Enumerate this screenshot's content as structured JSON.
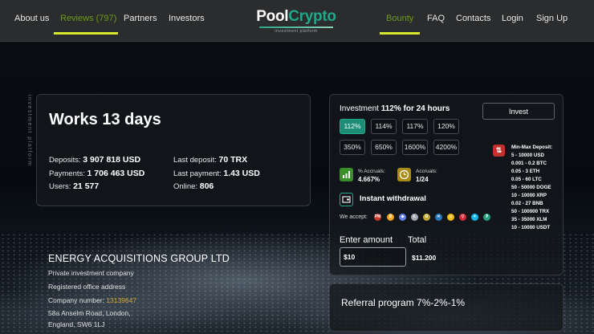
{
  "nav": {
    "left": [
      "About us",
      "Reviews (797)",
      "Partners",
      "Investors"
    ],
    "right": [
      "Bounty",
      "FAQ",
      "Contacts",
      "Login",
      "Sign Up"
    ]
  },
  "logo": {
    "pool": "Pool",
    "crypto": "Crypto",
    "tagline": "investment platform"
  },
  "vertical_text": "investment platform",
  "stats": {
    "title": "Works 13 days",
    "deposits_label": "Deposits:",
    "deposits": "3 907 818 USD",
    "payments_label": "Payments:",
    "payments": "1 706 463 USD",
    "users_label": "Users:",
    "users": "21 577",
    "last_deposit_label": "Last deposit:",
    "last_deposit": "70 TRX",
    "last_payment_label": "Last payment:",
    "last_payment": "1.43 USD",
    "online_label": "Online:",
    "online": "806"
  },
  "company": {
    "name": "ENERGY ACQUISITIONS GROUP LTD",
    "type": "Private investment company",
    "registered": "Registered office address",
    "number_label": "Company number:",
    "number": "13139647",
    "address1": "58a Anselm Road, London,",
    "address2": "England, SW6 1LJ"
  },
  "invest": {
    "head_prefix": "Investment",
    "head_bold": "112% for 24 hours",
    "button": "Invest",
    "rates": [
      "112%",
      "114%",
      "117%",
      "120%",
      "350%",
      "650%",
      "1600%",
      "4200%"
    ],
    "selected_rate": "112%",
    "accruals_pct_label": "% Accruals:",
    "accruals_pct": "4.667%",
    "accruals_label": "Accruals:",
    "accruals": "1/24",
    "instant": "Instant withdrawal",
    "we_accept": "We accept:",
    "min_max_title": "Min-Max Deposit:",
    "min_max": [
      "5 - 10000 USD",
      "0.001 - 0.2 BTC",
      "0.05 - 3 ETH",
      "0.05 - 60 LTC",
      "50 - 50000 DOGE",
      "10 - 10000 XRP",
      "0.02 - 27 BNB",
      "50 - 100000 TRX",
      "35 - 35000 XLM",
      "10 - 10000 USDT"
    ],
    "enter_amount": "Enter amount",
    "total": "Total",
    "amount_value": "$10",
    "total_value": "$11.200"
  },
  "referral": "Referral program 7%-2%-1%",
  "colors": {
    "accent": "#1e8d77",
    "nav_underline": "#d6e82a",
    "active_nav": "#6a9a1e",
    "brand": "#20a88a"
  }
}
